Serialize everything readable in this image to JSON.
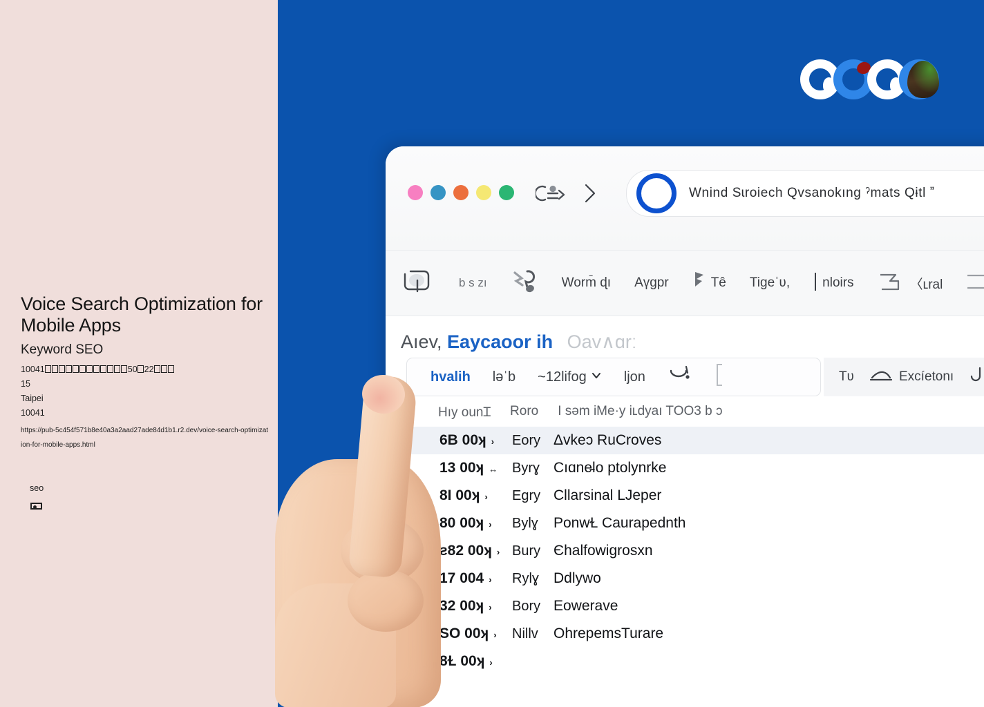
{
  "left_panel": {
    "title": "Voice Search Optimization for Mobile Apps",
    "subtitle": "Keyword SEO",
    "address_line": "10041□□□□□□□□□□□□50□22□□□",
    "number_line": "15",
    "city": "Taipei",
    "postal_code": "10041",
    "url": "https://pub-5c454f571b8e40a3a2aad27ade84d1b1.r2.dev/voice-search-optimization-for-mobile-apps.html",
    "tag": "seo",
    "bg_color": "#f0dedb"
  },
  "backdrop": {
    "color": "#0b53ad"
  },
  "logo": {
    "name": "search-engine-logo",
    "ring_colors": [
      "#ffffff",
      "#2f86e8",
      "#ffffff",
      "#2f86e8"
    ],
    "accent_red": "#9b1612",
    "accent_green": "#4a9630"
  },
  "browser": {
    "traffic_lights": [
      {
        "name": "window-dot-pink",
        "color": "#f77fc1"
      },
      {
        "name": "window-dot-blue",
        "color": "#3694c4"
      },
      {
        "name": "window-dot-orange",
        "color": "#ec6f3d"
      },
      {
        "name": "window-dot-yellow",
        "color": "#f5e873"
      },
      {
        "name": "window-dot-green",
        "color": "#2bb673"
      }
    ],
    "back_icon": "back-navigation-icon",
    "forward_icon": "chevron-right-icon",
    "omnibox": {
      "avatar_icon": "blue-ring-icon",
      "avatar_color": "#0d51cf",
      "text": "Wnind Sɩroiech Qvsanokıng ˀmats Qɨtl  ˮ"
    }
  },
  "toolbar": {
    "items": [
      {
        "name": "toolbar-item-1",
        "icon": "rounded-square-glyph-icon",
        "label": ""
      },
      {
        "name": "toolbar-item-2",
        "icon": "",
        "label": "b s zı"
      },
      {
        "name": "toolbar-item-3",
        "icon": "paint-splatter-glyph-icon",
        "label": ""
      },
      {
        "name": "toolbar-item-4",
        "icon": "",
        "label": "Worm̄ ɖı"
      },
      {
        "name": "toolbar-item-5",
        "icon": "",
        "label": "Aүgpr"
      },
      {
        "name": "toolbar-item-6",
        "icon": "flag-glyph-icon",
        "label": "Tê"
      },
      {
        "name": "toolbar-item-7",
        "icon": "",
        "label": "Tigeˈʋ,"
      },
      {
        "name": "toolbar-item-8",
        "icon": "vertical-bar-icon",
        "label": "nloirs"
      },
      {
        "name": "toolbar-item-9",
        "icon": "bracket-glyph-icon",
        "label": "〈ʟral"
      },
      {
        "name": "toolbar-item-10",
        "icon": "rect-glyph-icon",
        "label": ""
      }
    ]
  },
  "content": {
    "heading": {
      "part_dark": "Aıev,",
      "part_blue": "Eaycaoor ih",
      "part_muted": "Oav∧ɑrː"
    },
    "filter_bar": {
      "items": [
        {
          "name": "filter-tab-active",
          "label": "hvalih",
          "icon": "",
          "active": true
        },
        {
          "name": "filter-tab-2",
          "label": "ləˈb",
          "icon": ""
        },
        {
          "name": "filter-tab-3",
          "label": "~12lifog",
          "icon": "chevron-down-icon"
        },
        {
          "name": "filter-tab-4",
          "label": "ljon",
          "icon": ""
        },
        {
          "name": "filter-tab-5",
          "label": "",
          "icon": "magnifier-glyph-icon"
        },
        {
          "name": "filter-tab-6",
          "label": "",
          "icon": "bracket-tall-icon"
        }
      ],
      "right_items": [
        {
          "name": "filter-right-1",
          "label": "Tʋ",
          "icon": ""
        },
        {
          "name": "filter-right-2",
          "label": "Excíetonı",
          "icon": "shoe-glyph-icon"
        },
        {
          "name": "filter-right-3",
          "label": "",
          "icon": "hook-glyph-icon"
        }
      ]
    },
    "subheader": {
      "icon": "small-hook-icon",
      "items": [
        "Hıy ounꞮ",
        "Roro",
        "I səm iMe·y iʟdyaı TOO3 b ɔ"
      ]
    },
    "table": {
      "columns": [
        "volume",
        "keyword",
        "description"
      ],
      "rows": [
        {
          "volume": "6B 00ʞ",
          "arrow": "›",
          "keyword": "Eory",
          "description": "Δvkeɔ RuCroves",
          "highlight": true
        },
        {
          "volume": "13 00ʞ",
          "arrow": "↔",
          "keyword": "Byrɣ",
          "description": "Cıɑne̵lo ptolynrke",
          "highlight": false
        },
        {
          "volume": "8I 00ʞ",
          "arrow": "›",
          "keyword": "Egry",
          "description": "Cllarsinal LJeper",
          "highlight": false
        },
        {
          "volume": "80 00ʞ",
          "arrow": "›",
          "keyword": "Bylɣ",
          "description": "PonwⱢ Caurapednth",
          "highlight": false
        },
        {
          "volume": "ƨ82 00ʞ",
          "arrow": "›",
          "keyword": "Bury",
          "description": "Єhalfowigrosxn",
          "highlight": false
        },
        {
          "volume": "17 004",
          "arrow": "›",
          "keyword": "Rylɣ",
          "description": "Ddlywo",
          "highlight": false
        },
        {
          "volume": "32 00ʞ",
          "arrow": "›",
          "keyword": "Bory",
          "description": "Eowerave",
          "highlight": false
        },
        {
          "volume": "SO 00ʞ",
          "arrow": "›",
          "keyword": "Nillv",
          "description": "OhrepemsTurare",
          "highlight": false
        },
        {
          "volume": "8Ɫ 00ʞ",
          "arrow": "›",
          "keyword": "",
          "description": "",
          "highlight": false
        }
      ]
    }
  },
  "hand": {
    "name": "pointing-hand",
    "gesture": "index-finger-pointing-up"
  }
}
